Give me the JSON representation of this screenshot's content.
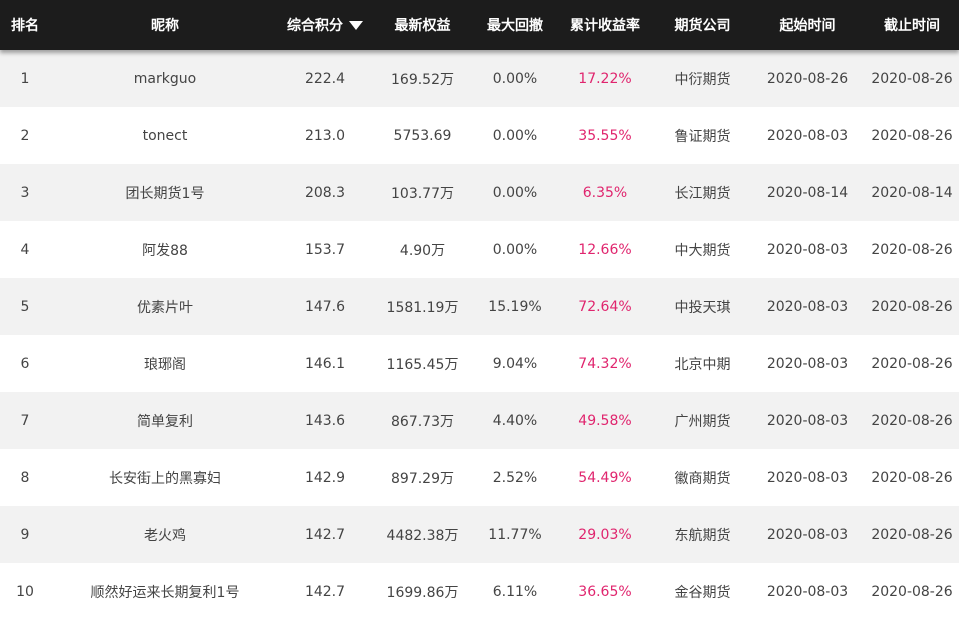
{
  "colors": {
    "header_bg": "#1c1c1c",
    "stripe": "#f2f2f2",
    "return_red": "#e0256e"
  },
  "header": {
    "rank": "排名",
    "name": "昵称",
    "score": "综合积分",
    "equity": "最新权益",
    "drawdown": "最大回撤",
    "return": "累计收益率",
    "company": "期货公司",
    "start": "起始时间",
    "end": "截止时间",
    "sort_icon": "caret-down-icon"
  },
  "rows": [
    {
      "rank": "1",
      "name": "markguo",
      "score": "222.4",
      "equity": "169.52万",
      "drawdown": "0.00%",
      "return": "17.22%",
      "company": "中衍期货",
      "start": "2020-08-26",
      "end": "2020-08-26"
    },
    {
      "rank": "2",
      "name": "tonect",
      "score": "213.0",
      "equity": "5753.69",
      "drawdown": "0.00%",
      "return": "35.55%",
      "company": "鲁证期货",
      "start": "2020-08-03",
      "end": "2020-08-26"
    },
    {
      "rank": "3",
      "name": "团长期货1号",
      "score": "208.3",
      "equity": "103.77万",
      "drawdown": "0.00%",
      "return": "6.35%",
      "company": "长江期货",
      "start": "2020-08-14",
      "end": "2020-08-14"
    },
    {
      "rank": "4",
      "name": "阿发88",
      "score": "153.7",
      "equity": "4.90万",
      "drawdown": "0.00%",
      "return": "12.66%",
      "company": "中大期货",
      "start": "2020-08-03",
      "end": "2020-08-26"
    },
    {
      "rank": "5",
      "name": "优素片叶",
      "score": "147.6",
      "equity": "1581.19万",
      "drawdown": "15.19%",
      "return": "72.64%",
      "company": "中投天琪",
      "start": "2020-08-03",
      "end": "2020-08-26"
    },
    {
      "rank": "6",
      "name": "琅琊阁",
      "score": "146.1",
      "equity": "1165.45万",
      "drawdown": "9.04%",
      "return": "74.32%",
      "company": "北京中期",
      "start": "2020-08-03",
      "end": "2020-08-26"
    },
    {
      "rank": "7",
      "name": "简单复利",
      "score": "143.6",
      "equity": "867.73万",
      "drawdown": "4.40%",
      "return": "49.58%",
      "company": "广州期货",
      "start": "2020-08-03",
      "end": "2020-08-26"
    },
    {
      "rank": "8",
      "name": "长安街上的黑寡妇",
      "score": "142.9",
      "equity": "897.29万",
      "drawdown": "2.52%",
      "return": "54.49%",
      "company": "徽商期货",
      "start": "2020-08-03",
      "end": "2020-08-26"
    },
    {
      "rank": "9",
      "name": "老火鸡",
      "score": "142.7",
      "equity": "4482.38万",
      "drawdown": "11.77%",
      "return": "29.03%",
      "company": "东航期货",
      "start": "2020-08-03",
      "end": "2020-08-26"
    },
    {
      "rank": "10",
      "name": "顺然好运来长期复利1号",
      "score": "142.7",
      "equity": "1699.86万",
      "drawdown": "6.11%",
      "return": "36.65%",
      "company": "金谷期货",
      "start": "2020-08-03",
      "end": "2020-08-26"
    }
  ]
}
